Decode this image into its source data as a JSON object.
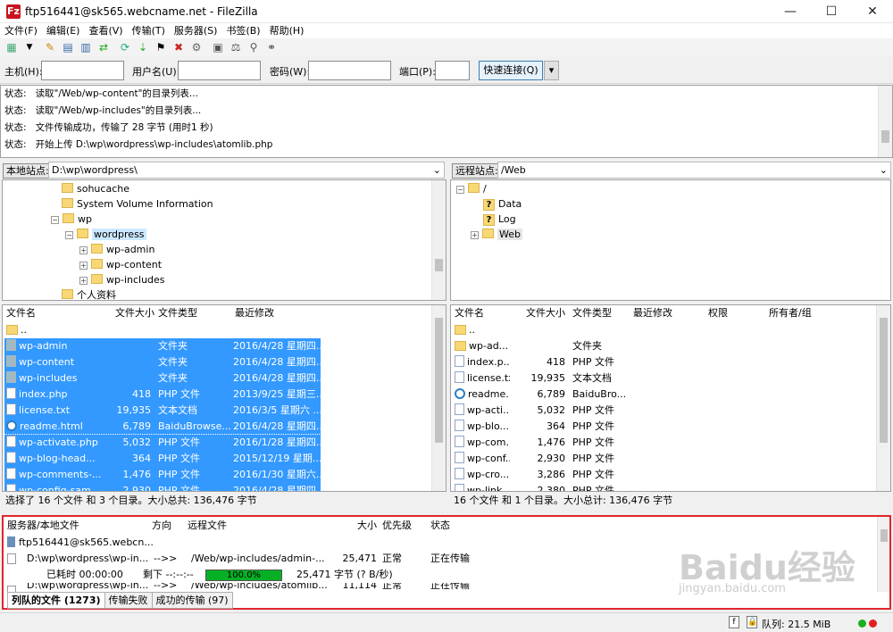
{
  "window": {
    "title": "ftp516441@sk565.webcname.net - FileZilla",
    "app_icon": "Fz",
    "min": "—",
    "max": "☐",
    "close": "✕"
  },
  "menu": [
    "文件(F)",
    "编辑(E)",
    "查看(V)",
    "传输(T)",
    "服务器(S)",
    "书签(B)",
    "帮助(H)"
  ],
  "quickconnect": {
    "host_label": "主机(H):",
    "user_label": "用户名(U):",
    "pass_label": "密码(W):",
    "port_label": "端口(P):",
    "button": "快速连接(Q)",
    "dropdown": "▾"
  },
  "log": [
    {
      "k": "状态:",
      "v": "读取\"/Web/wp-content\"的目录列表..."
    },
    {
      "k": "状态:",
      "v": "读取\"/Web/wp-includes\"的目录列表..."
    },
    {
      "k": "状态:",
      "v": "文件传输成功，传输了 28 字节 (用时1 秒)"
    },
    {
      "k": "状态:",
      "v": "开始上传 D:\\wp\\wordpress\\wp-includes\\atomlib.php"
    }
  ],
  "local": {
    "site_label": "本地站点:",
    "path": "D:\\wp\\wordpress\\",
    "tree": [
      "sohucache",
      "System Volume Information",
      "wp",
      "wordpress",
      "wp-admin",
      "wp-content",
      "wp-includes",
      "个人资料"
    ],
    "headers": [
      "文件名",
      "文件大小",
      "文件类型",
      "最近修改"
    ],
    "files": [
      {
        "name": "..",
        "size": "",
        "type": "",
        "mod": ""
      },
      {
        "name": "wp-admin",
        "size": "",
        "type": "文件夹",
        "mod": "2016/4/28 星期四..."
      },
      {
        "name": "wp-content",
        "size": "",
        "type": "文件夹",
        "mod": "2016/4/28 星期四..."
      },
      {
        "name": "wp-includes",
        "size": "",
        "type": "文件夹",
        "mod": "2016/4/28 星期四..."
      },
      {
        "name": "index.php",
        "size": "418",
        "type": "PHP 文件",
        "mod": "2013/9/25 星期三..."
      },
      {
        "name": "license.txt",
        "size": "19,935",
        "type": "文本文档",
        "mod": "2016/3/5 星期六 ..."
      },
      {
        "name": "readme.html",
        "size": "6,789",
        "type": "BaiduBrowse...",
        "mod": "2016/4/28 星期四..."
      },
      {
        "name": "wp-activate.php",
        "size": "5,032",
        "type": "PHP 文件",
        "mod": "2016/1/28 星期四..."
      },
      {
        "name": "wp-blog-head...",
        "size": "364",
        "type": "PHP 文件",
        "mod": "2015/12/19 星期..."
      },
      {
        "name": "wp-comments-...",
        "size": "1,476",
        "type": "PHP 文件",
        "mod": "2016/1/30 星期六..."
      },
      {
        "name": "wp-config-sam...",
        "size": "2,930",
        "type": "PHP 文件",
        "mod": "2016/4/28 星期四..."
      }
    ],
    "status": "选择了 16 个文件 和 3 个目录。大小总共: 136,476 字节"
  },
  "remote": {
    "site_label": "远程站点:",
    "path": "/Web",
    "tree": [
      "/",
      "Data",
      "Log",
      "Web"
    ],
    "headers": [
      "文件名",
      "文件大小",
      "文件类型",
      "最近修改",
      "权限",
      "所有者/组"
    ],
    "files": [
      {
        "name": "..",
        "size": "",
        "type": ""
      },
      {
        "name": "wp-ad...",
        "size": "",
        "type": "文件夹"
      },
      {
        "name": "index.p...",
        "size": "418",
        "type": "PHP 文件"
      },
      {
        "name": "license.txt",
        "size": "19,935",
        "type": "文本文档"
      },
      {
        "name": "readme...",
        "size": "6,789",
        "type": "BaiduBro..."
      },
      {
        "name": "wp-acti...",
        "size": "5,032",
        "type": "PHP 文件"
      },
      {
        "name": "wp-blo...",
        "size": "364",
        "type": "PHP 文件"
      },
      {
        "name": "wp-com...",
        "size": "1,476",
        "type": "PHP 文件"
      },
      {
        "name": "wp-conf...",
        "size": "2,930",
        "type": "PHP 文件"
      },
      {
        "name": "wp-cro...",
        "size": "3,286",
        "type": "PHP 文件"
      },
      {
        "name": "wp-link...",
        "size": "2,380",
        "type": "PHP 文件"
      }
    ],
    "status": "16 个文件 和 1 个目录。大小总计: 136,476 字节"
  },
  "queue": {
    "headers": [
      "服务器/本地文件",
      "方向",
      "远程文件",
      "大小",
      "优先级",
      "状态"
    ],
    "server": "ftp516441@sk565.webcn...",
    "rows": [
      {
        "local": "D:\\wp\\wordpress\\wp-in...",
        "dir": "-->>",
        "remote": "/Web/wp-includes/admin-...",
        "size": "25,471",
        "prio": "正常",
        "status": "正在传输"
      },
      {
        "local": "D:\\wp\\wordpress\\wp-in...",
        "dir": "-->>",
        "remote": "/Web/wp-includes/atomlib...",
        "size": "11,114",
        "prio": "正常",
        "status": "正在传输"
      }
    ],
    "elapsed": "已耗时 00:00:00",
    "remaining": "剩下 --:--:--",
    "progress": "100.0%",
    "progress_fraction": 1.0,
    "bytes": "25,471 字节 (? B/秒)"
  },
  "tabs": [
    "列队的文件 (1273)",
    "传输失败",
    "成功的传输 (97)"
  ],
  "bottom": {
    "queue_text": "队列: 21.5 MiB"
  },
  "watermark": {
    "brand": "Baidu经验",
    "url": "jingyan.baidu.com"
  },
  "colors": {
    "selection": "#3399ff",
    "progress": "#06b025",
    "highlight_border": "#e0262c"
  }
}
